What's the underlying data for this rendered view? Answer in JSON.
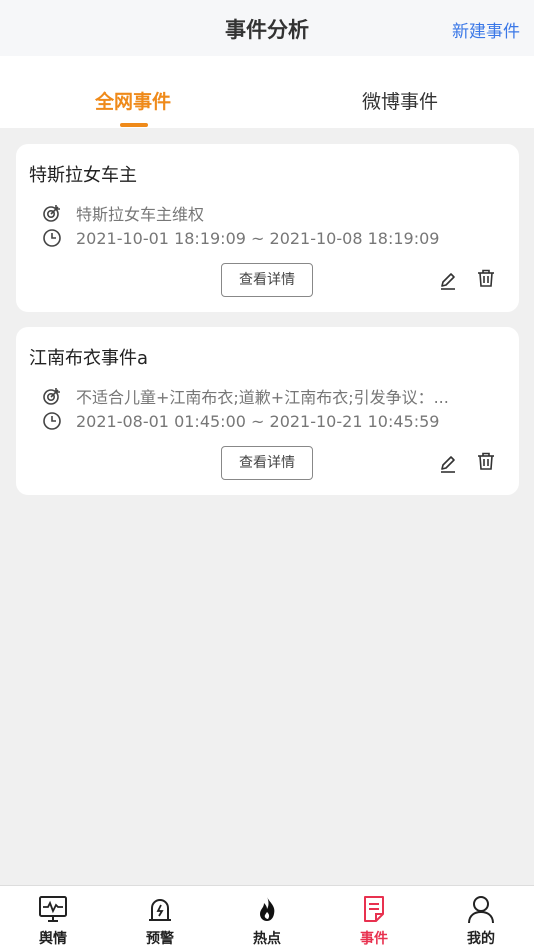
{
  "header": {
    "title": "事件分析",
    "new_event": "新建事件"
  },
  "tabs": [
    {
      "label": "全网事件",
      "active": true
    },
    {
      "label": "微博事件",
      "active": false
    }
  ],
  "accent_color": "#ef8a1a",
  "events": [
    {
      "name": "特斯拉女车主",
      "keywords": "特斯拉女车主维权",
      "time_range": "2021-10-01 18:19:09 ~ 2021-10-08 18:19:09",
      "detail_label": "查看详情"
    },
    {
      "name": "江南布衣事件a",
      "keywords": "不适合儿童+江南布衣;道歉+江南布衣;引发争议：...",
      "time_range": "2021-08-01 01:45:00 ~ 2021-10-21 10:45:59",
      "detail_label": "查看详情"
    }
  ],
  "nav": [
    {
      "label": "舆情",
      "icon": "monitor-icon",
      "active": false
    },
    {
      "label": "预警",
      "icon": "alarm-icon",
      "active": false
    },
    {
      "label": "热点",
      "icon": "fire-icon",
      "active": false
    },
    {
      "label": "事件",
      "icon": "event-icon",
      "active": true
    },
    {
      "label": "我的",
      "icon": "user-icon",
      "active": false
    }
  ],
  "nav_active_color": "#e8314f"
}
